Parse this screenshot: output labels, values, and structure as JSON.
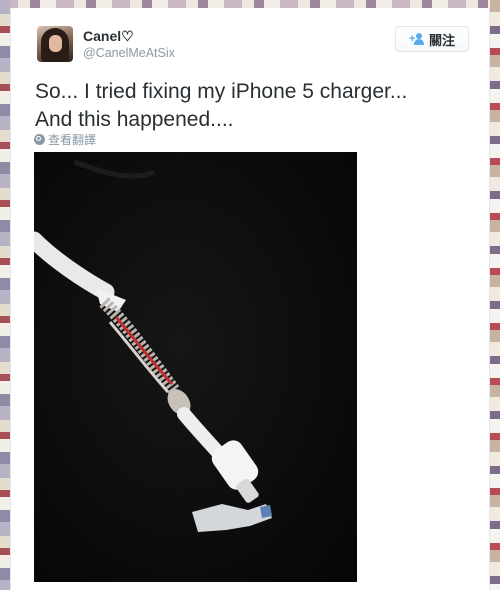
{
  "user": {
    "display_name": "Canel♡",
    "handle": "@CanelMeAtSix"
  },
  "follow_button": {
    "label": "關注",
    "icon": "add-user-icon"
  },
  "tweet": {
    "text": "So... I tried fixing my iPhone 5 charger...\nAnd this happened....",
    "translate_label": "查看翻譯",
    "translate_icon": "globe-icon"
  },
  "colors": {
    "accent": "#55acee",
    "text": "#292f33",
    "muted": "#8899a6",
    "photo_background": "#0c0c0c"
  }
}
